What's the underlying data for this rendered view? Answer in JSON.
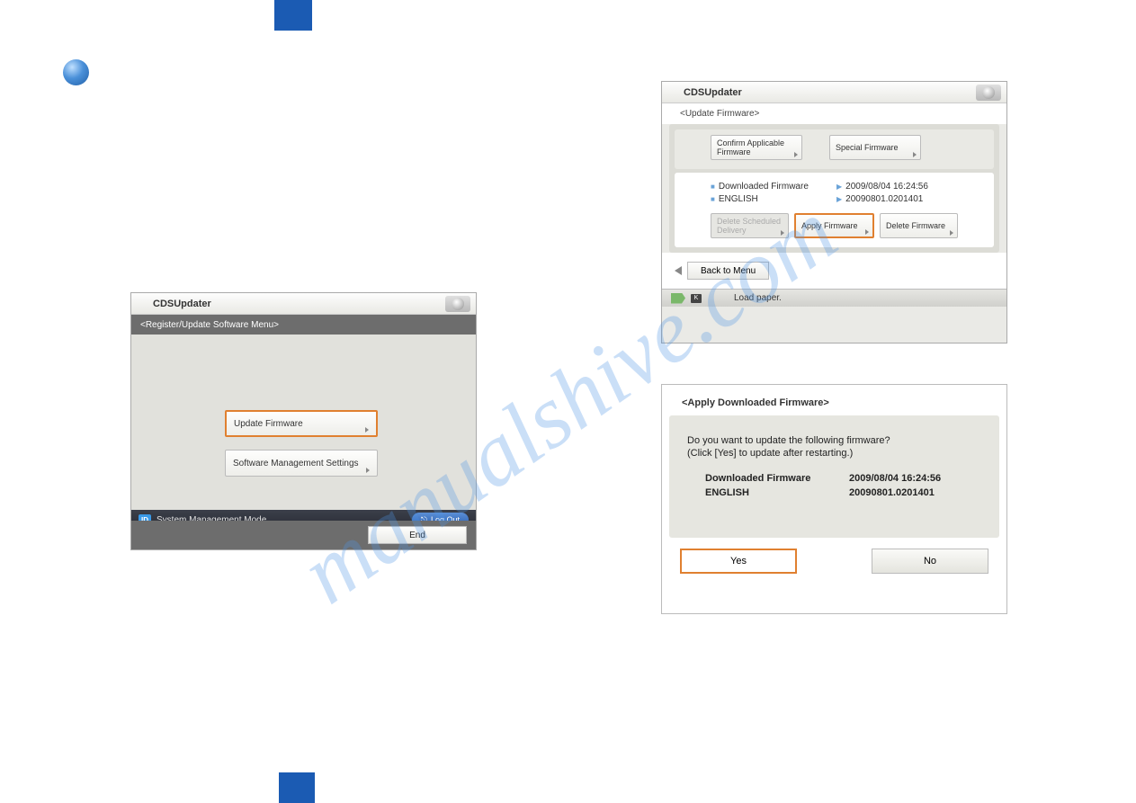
{
  "watermark": "manualshive.com",
  "shot1": {
    "title": "CDSUpdater",
    "breadcrumb": "<Register/Update Software Menu>",
    "btn_update": "Update Firmware",
    "btn_settings": "Software Management Settings",
    "end": "End",
    "status_mode": "System Management Mode",
    "id_badge": "ID",
    "logout": "Log Out"
  },
  "shot2": {
    "title": "CDSUpdater",
    "breadcrumb": "<Update Firmware>",
    "btn_confirm": "Confirm Applicable Firmware",
    "btn_special": "Special Firmware",
    "label_downloaded": "Downloaded Firmware",
    "val_date": "2009/08/04 16:24:56",
    "label_lang": "ENGLISH",
    "val_version": "20090801.0201401",
    "btn_delete_sched": "Delete Scheduled Delivery",
    "btn_apply": "Apply Firmware",
    "btn_delete": "Delete Firmware",
    "back": "Back to Menu",
    "k_badge": "K",
    "status": "Load paper."
  },
  "shot3": {
    "breadcrumb": "<Apply Downloaded Firmware>",
    "question1": "Do you want to update the following firmware?",
    "question2": "(Click [Yes] to update after restarting.)",
    "label_downloaded": "Downloaded Firmware",
    "val_date": "2009/08/04 16:24:56",
    "label_lang": "ENGLISH",
    "val_version": "20090801.0201401",
    "yes": "Yes",
    "no": "No"
  }
}
